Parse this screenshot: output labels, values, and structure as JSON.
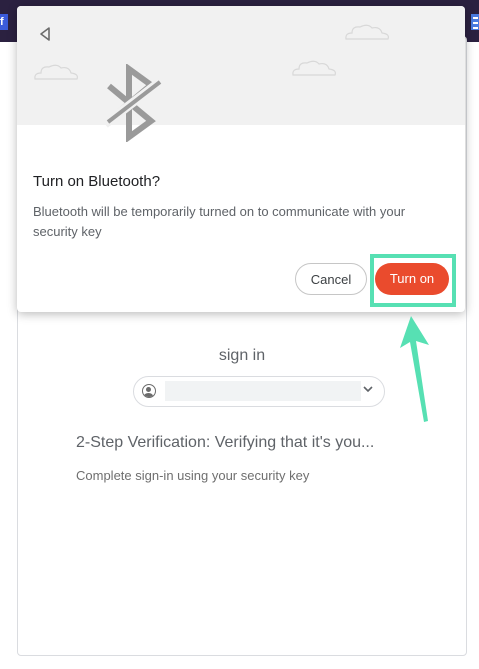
{
  "dialog": {
    "title": "Turn on Bluetooth?",
    "body": "Bluetooth will be temporarily turned on to communicate with your security key",
    "cancel_label": "Cancel",
    "turn_on_label": "Turn on",
    "icons": [
      "back-triangle-icon",
      "bluetooth-icon",
      "cloud-icon"
    ]
  },
  "page": {
    "sign_in_text": "sign in",
    "verify_title": "2-Step Verification: Verifying that it's you...",
    "verify_subtitle": "Complete sign-in using your security key",
    "account_chip_icons": [
      "account-circle-icon",
      "chevron-down-icon"
    ]
  },
  "colors": {
    "turn_on_button": "#ea4b2d",
    "highlight": "#57e0b3",
    "top_bar": "#2b2140",
    "header_bg": "#f1f1f1"
  }
}
